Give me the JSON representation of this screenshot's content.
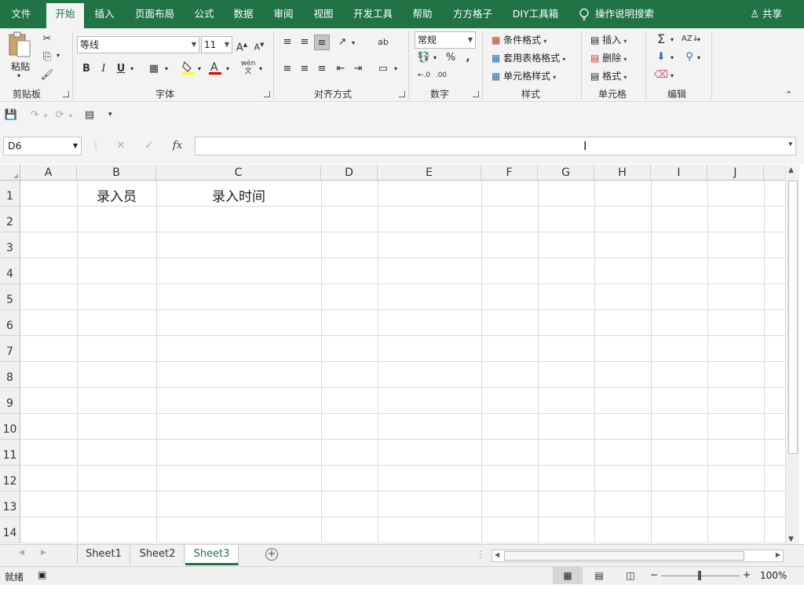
{
  "ribbon_tabs": [
    "文件",
    "开始",
    "插入",
    "页面布局",
    "公式",
    "数据",
    "审阅",
    "视图",
    "开发工具",
    "帮助",
    "方方格子",
    "DIY工具箱"
  ],
  "tell_me": "操作说明搜索",
  "share": "共享",
  "clipboard": {
    "paste": "粘贴",
    "label": "剪贴板"
  },
  "font": {
    "name": "等线",
    "size": "11",
    "label": "字体",
    "bold": "B",
    "italic": "I",
    "underline": "U",
    "phonetic": "wén"
  },
  "alignment": {
    "label": "对齐方式"
  },
  "number": {
    "format": "常规",
    "label": "数字",
    "percent": "%",
    "comma": ","
  },
  "styles": {
    "conditional": "条件格式",
    "table": "套用表格格式",
    "cell": "单元格样式",
    "label": "样式"
  },
  "cells": {
    "insert": "插入",
    "delete": "删除",
    "format": "格式",
    "label": "单元格"
  },
  "editing": {
    "label": "编辑"
  },
  "name_box": "D6",
  "fx": "fx",
  "columns": [
    "A",
    "B",
    "C",
    "D",
    "E",
    "F",
    "G",
    "H",
    "I",
    "J"
  ],
  "rows": [
    "1",
    "2",
    "3",
    "4",
    "5",
    "6",
    "7",
    "8",
    "9",
    "10",
    "11",
    "12",
    "13",
    "14"
  ],
  "cells_data": {
    "B1": "录入员",
    "C1": "录入时间"
  },
  "sheets": [
    "Sheet1",
    "Sheet2",
    "Sheet3"
  ],
  "active_sheet": "Sheet3",
  "status": {
    "ready": "就绪",
    "zoom": "100%"
  },
  "colors": {
    "accent": "#217346",
    "ribbon_bg": "#f3f3f3"
  }
}
